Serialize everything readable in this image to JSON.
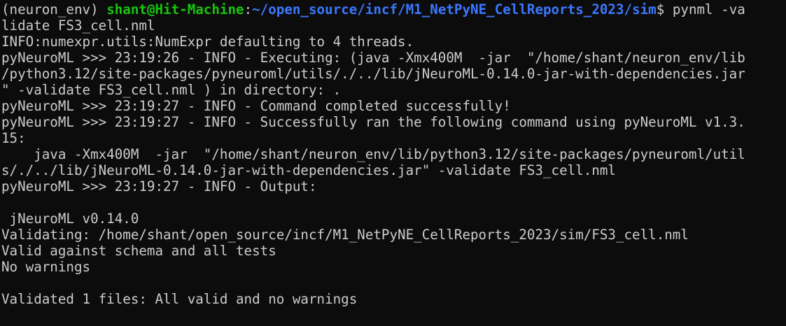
{
  "prompt": {
    "env": "(neuron_env) ",
    "user_host": "shant@Hit-Machine",
    "separator": ":",
    "path": "~/open_source/incf/M1_NetPyNE_CellReports_2023/sim",
    "symbol": "$ ",
    "command": "pynml -va"
  },
  "output_lines": [
    "lidate FS3_cell.nml",
    "INFO:numexpr.utils:NumExpr defaulting to 4 threads.",
    "pyNeuroML >>> 23:19:26 - INFO - Executing: (java -Xmx400M  -jar  \"/home/shant/neuron_env/lib",
    "/python3.12/site-packages/pyneuroml/utils/./../lib/jNeuroML-0.14.0-jar-with-dependencies.jar",
    "\" -validate FS3_cell.nml ) in directory: .",
    "pyNeuroML >>> 23:19:27 - INFO - Command completed successfully!",
    "pyNeuroML >>> 23:19:27 - INFO - Successfully ran the following command using pyNeuroML v1.3.",
    "15:",
    "    java -Xmx400M  -jar  \"/home/shant/neuron_env/lib/python3.12/site-packages/pyneuroml/util",
    "s/./../lib/jNeuroML-0.14.0-jar-with-dependencies.jar\" -validate FS3_cell.nml",
    "pyNeuroML >>> 23:19:27 - INFO - Output:",
    "",
    " jNeuroML v0.14.0",
    "Validating: /home/shant/open_source/incf/M1_NetPyNE_CellReports_2023/sim/FS3_cell.nml",
    "Valid against schema and all tests",
    "No warnings",
    "",
    "Validated 1 files: All valid and no warnings"
  ],
  "colors": {
    "background": "#0c0c0c",
    "foreground": "#cccccc",
    "user_host": "#16c60c",
    "path": "#3b78ff"
  }
}
